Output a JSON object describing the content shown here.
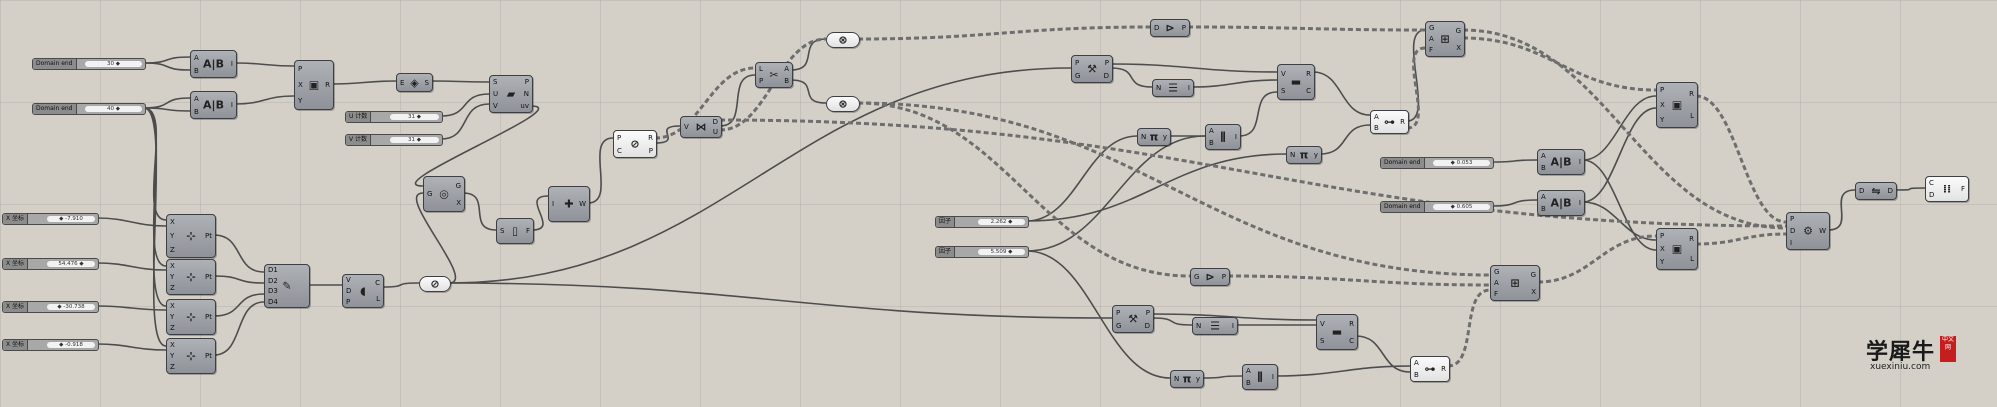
{
  "sliders": {
    "domain_end_1": {
      "label": "Domain end",
      "value": "30 ◆"
    },
    "domain_end_2": {
      "label": "Domain end",
      "value": "40 ◆"
    },
    "u_count": {
      "label": "U 计数",
      "value": "31 ◆"
    },
    "v_count": {
      "label": "V 计数",
      "value": "31 ◆"
    },
    "x_coord_1": {
      "label": "X 坐标",
      "value": "◆ -7.910"
    },
    "x_coord_2": {
      "label": "X 坐标",
      "value": "54.476 ◆"
    },
    "x_coord_3": {
      "label": "X 坐标",
      "value": "◆ -30.738"
    },
    "x_coord_4": {
      "label": "X 坐标",
      "value": "◆ -0.918"
    },
    "factor_1": {
      "label": "因子",
      "value": "2.262 ◆"
    },
    "factor_2": {
      "label": "因子",
      "value": "5.509 ◆"
    },
    "domain_end_3": {
      "label": "Domain end",
      "value": "◆ 0.053"
    },
    "domain_end_4": {
      "label": "Domain end",
      "value": "◆ 0.605"
    }
  },
  "components": {
    "construct_domain_1": {
      "icon": "A|B",
      "pins_in": [
        "A",
        "B"
      ],
      "pins_out": [
        "I"
      ]
    },
    "construct_domain_2": {
      "icon": "A|B",
      "pins_in": [
        "A",
        "B"
      ],
      "pins_out": [
        "I"
      ]
    },
    "domain_square": {
      "icon": "▣",
      "pins_in": [
        "P",
        "X",
        "Y"
      ],
      "pins_out": [
        "R"
      ]
    },
    "plane_surface": {
      "icon": "◈",
      "pins_in": [
        "E"
      ],
      "pins_out": [
        "S"
      ]
    },
    "divide_surface": {
      "icon": "▰",
      "pins_in": [
        "S",
        "U",
        "V"
      ],
      "pins_out": [
        "P",
        "N",
        "uv"
      ]
    },
    "point_xyz_1": {
      "icon": "⊹",
      "pins_in": [
        "X",
        "Y",
        "Z"
      ],
      "pins_out": [
        "Pt"
      ]
    },
    "point_xyz_2": {
      "icon": "⊹",
      "pins_in": [
        "X",
        "Y",
        "Z"
      ],
      "pins_out": [
        "Pt"
      ]
    },
    "point_xyz_3": {
      "icon": "⊹",
      "pins_in": [
        "X",
        "Y",
        "Z"
      ],
      "pins_out": [
        "Pt"
      ]
    },
    "point_xyz_4": {
      "icon": "⊹",
      "pins_in": [
        "X",
        "Y",
        "Z"
      ],
      "pins_out": [
        "Pt"
      ]
    },
    "graph_mapper": {
      "icon": "✎",
      "pins_in": [
        "D1",
        "D2",
        "D3",
        "D4"
      ],
      "pins_out": []
    },
    "curve_divide": {
      "icon": "◖",
      "pins_in": [
        "V",
        "D",
        "P"
      ],
      "pins_out": [
        "C",
        "L"
      ]
    },
    "area": {
      "icon": "◎",
      "pins_in": [
        "G"
      ],
      "pins_out": [
        "G",
        "X"
      ]
    },
    "pull_point": {
      "icon": "▯",
      "pins_in": [
        "S"
      ],
      "pins_out": [
        "F"
      ]
    },
    "weave": {
      "icon": "✚",
      "pins_in": [
        "I"
      ],
      "pins_out": [
        "W"
      ]
    },
    "closest_point": {
      "icon": "⊘",
      "pins_in": [
        "P",
        "C"
      ],
      "pins_out": [
        "R",
        "P"
      ]
    },
    "evaluate_surface": {
      "icon": "⋈",
      "pins_in": [
        "V"
      ],
      "pins_out": [
        "D",
        "U"
      ]
    },
    "cull_pattern": {
      "icon": "✂",
      "pins_in": [
        "L",
        "P"
      ],
      "pins_out": [
        "A",
        "B"
      ]
    },
    "deconstruct_top": {
      "icon": "⚒",
      "pins_in": [
        "P",
        "G"
      ],
      "pins_out": [
        "P",
        "D"
      ]
    },
    "list_item_top": {
      "icon": "☰",
      "pins_in": [
        "N"
      ],
      "pins_out": [
        "I"
      ]
    },
    "merge_top": {
      "icon": "▬",
      "pins_in": [
        "V",
        "S"
      ],
      "pins_out": [
        "R",
        "C"
      ]
    },
    "pi_top": {
      "icon": "π",
      "pins_in": [
        "N"
      ],
      "pins_out": [
        "y"
      ]
    },
    "bounds_top": {
      "icon": "⫼",
      "pins_in": [
        "A",
        "B"
      ],
      "pins_out": [
        "I"
      ]
    },
    "range_top": {
      "icon": "⊶",
      "pins_in": [
        "A",
        "B"
      ],
      "pins_out": [
        "R"
      ]
    },
    "cross_top": {
      "icon": "⊞",
      "pins_in": [
        "G",
        "A",
        "F"
      ],
      "pins_out": [
        "G",
        "X"
      ]
    },
    "filter_top": {
      "icon": "⊳",
      "pins_in": [
        "D"
      ],
      "pins_out": [
        "P"
      ]
    },
    "pi_mid": {
      "icon": "π",
      "pins_in": [
        "N"
      ],
      "pins_out": [
        "y"
      ]
    },
    "domain_mid_1": {
      "icon": "A|B",
      "pins_in": [
        "A",
        "B"
      ],
      "pins_out": [
        "I"
      ]
    },
    "domain_mid_2": {
      "icon": "A|B",
      "pins_in": [
        "A",
        "B"
      ],
      "pins_out": [
        "I"
      ]
    },
    "bounds_right_1": {
      "icon": "▣",
      "pins_in": [
        "P",
        "X",
        "Y"
      ],
      "pins_out": [
        "R",
        "L"
      ]
    },
    "bounds_right_2": {
      "icon": "▣",
      "pins_in": [
        "P",
        "X",
        "Y"
      ],
      "pins_out": [
        "R",
        "L"
      ]
    },
    "loft": {
      "icon": "⚙",
      "pins_in": [
        "P",
        "D",
        "I"
      ],
      "pins_out": [
        "W"
      ]
    },
    "flip": {
      "icon": "⇋",
      "pins_in": [
        "D"
      ],
      "pins_out": [
        "D"
      ]
    },
    "output_grid": {
      "icon": "⁞⁞",
      "pins_in": [
        "C",
        "D"
      ],
      "pins_out": [
        "F"
      ]
    },
    "filter_mid": {
      "icon": "⊳",
      "pins_in": [
        "G"
      ],
      "pins_out": [
        "P"
      ]
    },
    "cross_mid": {
      "icon": "⊞",
      "pins_in": [
        "G",
        "A",
        "F"
      ],
      "pins_out": [
        "G",
        "X"
      ]
    },
    "deconstruct_bot": {
      "icon": "⚒",
      "pins_in": [
        "P",
        "G"
      ],
      "pins_out": [
        "P",
        "D"
      ]
    },
    "list_item_bot": {
      "icon": "☰",
      "pins_in": [
        "N"
      ],
      "pins_out": [
        "I"
      ]
    },
    "merge_bot": {
      "icon": "▬",
      "pins_in": [
        "V",
        "S"
      ],
      "pins_out": [
        "R",
        "C"
      ]
    },
    "pi_bot": {
      "icon": "π",
      "pins_in": [
        "N"
      ],
      "pins_out": [
        "y"
      ]
    },
    "bounds_bot": {
      "icon": "⫼",
      "pins_in": [
        "A",
        "B"
      ],
      "pins_out": [
        "I"
      ]
    },
    "range_bot": {
      "icon": "⊶",
      "pins_in": [
        "A",
        "B"
      ],
      "pins_out": [
        "R"
      ]
    },
    "relay_1": {
      "icon": "⊗",
      "pins_in": [],
      "pins_out": []
    },
    "relay_2": {
      "icon": "⊗",
      "pins_in": [],
      "pins_out": []
    },
    "relay_3": {
      "icon": "⊘",
      "pins_in": [],
      "pins_out": []
    }
  },
  "watermark": {
    "brand": "学犀牛",
    "badge": "中文网",
    "url": "xuexiniu.com"
  }
}
